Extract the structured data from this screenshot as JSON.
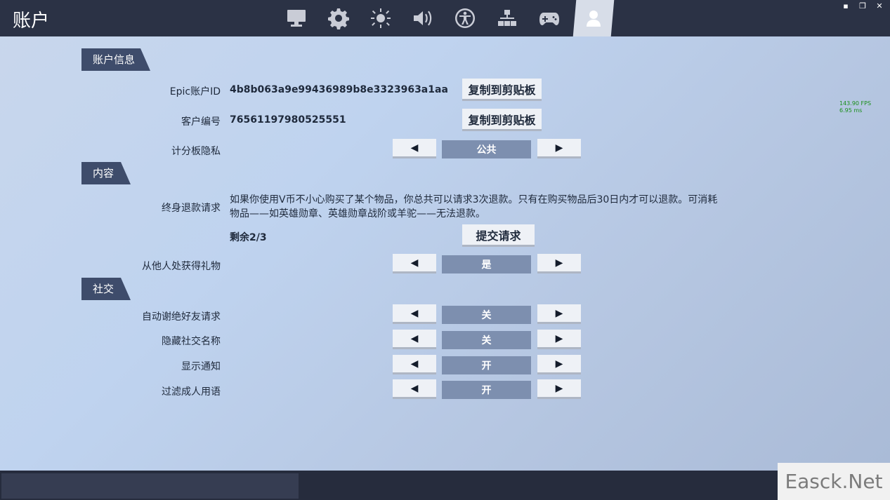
{
  "header": {
    "title": "账户",
    "tabs": [
      {
        "icon": "monitor-icon"
      },
      {
        "icon": "gear-icon"
      },
      {
        "icon": "brightness-icon"
      },
      {
        "icon": "speaker-icon"
      },
      {
        "icon": "accessibility-icon"
      },
      {
        "icon": "network-icon"
      },
      {
        "icon": "gamepad-icon"
      },
      {
        "icon": "user-icon",
        "active": true
      }
    ],
    "window_controls": [
      "▪",
      "❐",
      "✕"
    ]
  },
  "sections": {
    "account_info": "账户信息",
    "content": "内容",
    "social": "社交"
  },
  "account": {
    "epic_label": "Epic账户ID",
    "epic_id": "4b8b063a9e99436989b8e3323963a1aa",
    "customer_label": "客户编号",
    "customer_id": "76561197980525551",
    "copy_label": "复制到剪贴板",
    "scoreboard_label": "计分板隐私",
    "scoreboard_value": "公共"
  },
  "content": {
    "refund_label": "终身退款请求",
    "refund_desc": "如果你使用V币不小心购买了某个物品，你总共可以请求3次退款。只有在购买物品后30日内才可以退款。可消耗物品——如英雄勋章、英雄勋章战阶或羊驼——无法退款。",
    "remaining": "剩余2/3",
    "submit_label": "提交请求",
    "gift_label": "从他人处获得礼物",
    "gift_value": "是"
  },
  "social": {
    "auto_decline_label": "自动谢绝好友请求",
    "auto_decline_value": "关",
    "hide_name_label": "隐藏社交名称",
    "hide_name_value": "关",
    "notify_label": "显示通知",
    "notify_value": "开",
    "filter_label": "过滤成人用语",
    "filter_value": "开"
  },
  "arrows": {
    "left": "◀",
    "right": "▶"
  },
  "fps": {
    "fps_text": "143.90 FPS",
    "ms_text": "6.95 ms"
  },
  "watermark": "Easck.Net"
}
